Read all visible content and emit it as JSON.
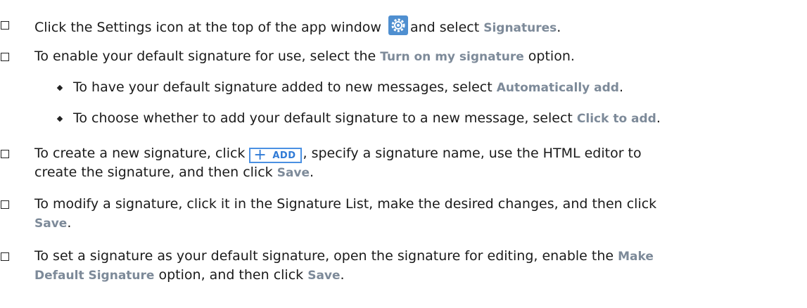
{
  "colors": {
    "keyword": "#7d8a99",
    "accent": "#4a90e2",
    "icon_bg": "#4f8fd0"
  },
  "items": [
    {
      "pre": "Click the Settings icon at the top of the app window",
      "icon": "gear-icon",
      "mid": "and select ",
      "kw": "Signatures",
      "post": "."
    },
    {
      "pre": "To enable your default signature for use, select the ",
      "kw": "Turn on my signature",
      "post": " option."
    },
    {
      "pre": "To have your default signature added to new messages, select ",
      "kw": "Automatically add",
      "post": "."
    },
    {
      "pre": "To choose whether to add your default signature to a new message, select ",
      "kw": "Click to add",
      "post": "."
    },
    {
      "pre": "To create a new signature, click",
      "button_plus": "+",
      "button_label": "ADD",
      "mid": ", specify a signature name, use the HTML editor to",
      "line2": "create the signature, and then click ",
      "kw": "Save",
      "post": "."
    },
    {
      "pre": "To modify a signature, click it in the Signature List, make the desired changes, and then click",
      "kw": "Save",
      "post": "."
    },
    {
      "pre": "To set a signature as your default signature, open the signature for editing, enable the ",
      "kw1": "Make",
      "kw2": "Default Signature",
      "post": " option, and then click ",
      "kw3": "Save",
      "post2": "."
    }
  ]
}
